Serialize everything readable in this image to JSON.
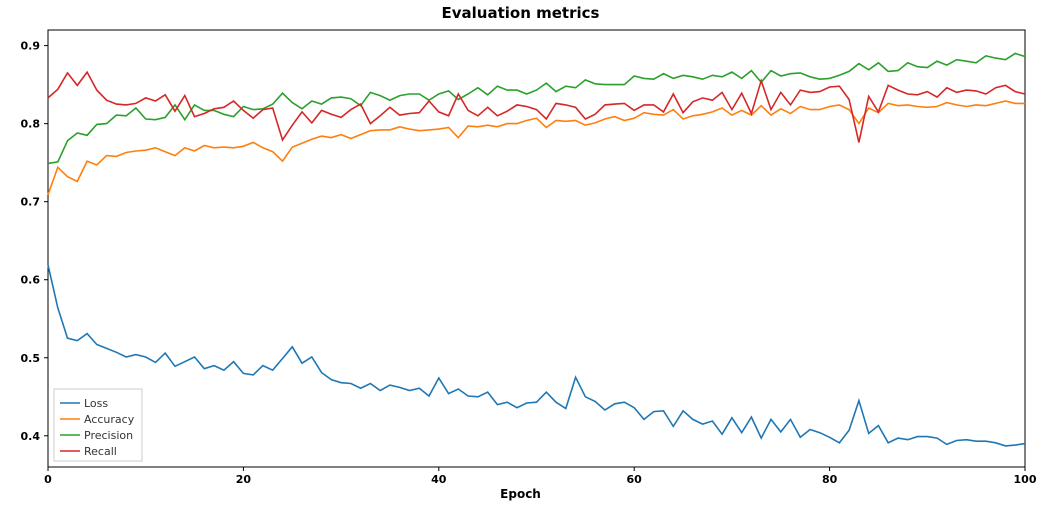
{
  "chart_data": {
    "type": "line",
    "title": "Evaluation metrics",
    "xlabel": "Epoch",
    "ylabel": "",
    "xlim": [
      0,
      100
    ],
    "ylim": [
      0.36,
      0.92
    ],
    "x_ticks": [
      0,
      20,
      40,
      60,
      80,
      100
    ],
    "y_ticks": [
      0.4,
      0.5,
      0.6,
      0.7,
      0.8,
      0.9
    ],
    "legend_position": "lower-left",
    "colors": {
      "Loss": "#1f77b4",
      "Accuracy": "#ff7f0e",
      "Precision": "#2ca02c",
      "Recall": "#d62728"
    },
    "x": [
      0,
      1,
      2,
      3,
      4,
      5,
      6,
      7,
      8,
      9,
      10,
      11,
      12,
      13,
      14,
      15,
      16,
      17,
      18,
      19,
      20,
      21,
      22,
      23,
      24,
      25,
      26,
      27,
      28,
      29,
      30,
      31,
      32,
      33,
      34,
      35,
      36,
      37,
      38,
      39,
      40,
      41,
      42,
      43,
      44,
      45,
      46,
      47,
      48,
      49,
      50,
      51,
      52,
      53,
      54,
      55,
      56,
      57,
      58,
      59,
      60,
      61,
      62,
      63,
      64,
      65,
      66,
      67,
      68,
      69,
      70,
      71,
      72,
      73,
      74,
      75,
      76,
      77,
      78,
      79,
      80,
      81,
      82,
      83,
      84,
      85,
      86,
      87,
      88,
      89,
      90,
      91,
      92,
      93,
      94,
      95,
      96,
      97,
      98,
      99,
      100
    ],
    "series": [
      {
        "name": "Loss",
        "values": [
          0.619,
          0.564,
          0.525,
          0.522,
          0.531,
          0.517,
          0.512,
          0.507,
          0.501,
          0.504,
          0.501,
          0.494,
          0.506,
          0.489,
          0.495,
          0.501,
          0.486,
          0.49,
          0.484,
          0.495,
          0.48,
          0.478,
          0.49,
          0.484,
          0.499,
          0.514,
          0.493,
          0.501,
          0.481,
          0.472,
          0.468,
          0.467,
          0.461,
          0.467,
          0.458,
          0.465,
          0.462,
          0.458,
          0.461,
          0.451,
          0.474,
          0.454,
          0.46,
          0.451,
          0.45,
          0.456,
          0.44,
          0.443,
          0.436,
          0.442,
          0.443,
          0.456,
          0.443,
          0.435,
          0.475,
          0.45,
          0.444,
          0.433,
          0.441,
          0.443,
          0.436,
          0.421,
          0.431,
          0.432,
          0.412,
          0.432,
          0.421,
          0.415,
          0.419,
          0.402,
          0.423,
          0.404,
          0.424,
          0.397,
          0.421,
          0.405,
          0.421,
          0.398,
          0.408,
          0.404,
          0.398,
          0.391,
          0.407,
          0.445,
          0.403,
          0.413,
          0.391,
          0.397,
          0.395,
          0.399,
          0.399,
          0.397,
          0.389,
          0.394,
          0.395,
          0.393,
          0.393,
          0.391,
          0.387,
          0.388,
          0.39
        ]
      },
      {
        "name": "Accuracy",
        "values": [
          0.709,
          0.744,
          0.732,
          0.726,
          0.752,
          0.747,
          0.759,
          0.758,
          0.763,
          0.765,
          0.766,
          0.769,
          0.764,
          0.759,
          0.769,
          0.765,
          0.772,
          0.769,
          0.77,
          0.769,
          0.771,
          0.776,
          0.769,
          0.764,
          0.752,
          0.77,
          0.775,
          0.78,
          0.784,
          0.782,
          0.786,
          0.781,
          0.786,
          0.791,
          0.792,
          0.792,
          0.796,
          0.793,
          0.791,
          0.792,
          0.793,
          0.795,
          0.782,
          0.797,
          0.796,
          0.798,
          0.796,
          0.8,
          0.8,
          0.804,
          0.807,
          0.795,
          0.804,
          0.803,
          0.804,
          0.798,
          0.801,
          0.806,
          0.809,
          0.804,
          0.807,
          0.814,
          0.812,
          0.811,
          0.818,
          0.806,
          0.81,
          0.812,
          0.815,
          0.82,
          0.811,
          0.817,
          0.811,
          0.823,
          0.811,
          0.819,
          0.813,
          0.822,
          0.818,
          0.818,
          0.822,
          0.824,
          0.818,
          0.8,
          0.82,
          0.814,
          0.826,
          0.823,
          0.824,
          0.822,
          0.821,
          0.822,
          0.827,
          0.824,
          0.822,
          0.824,
          0.823,
          0.826,
          0.829,
          0.826,
          0.826
        ]
      },
      {
        "name": "Precision",
        "values": [
          0.749,
          0.751,
          0.778,
          0.788,
          0.785,
          0.799,
          0.8,
          0.811,
          0.81,
          0.82,
          0.806,
          0.805,
          0.808,
          0.824,
          0.805,
          0.824,
          0.817,
          0.817,
          0.812,
          0.809,
          0.822,
          0.818,
          0.819,
          0.825,
          0.839,
          0.827,
          0.819,
          0.829,
          0.825,
          0.833,
          0.834,
          0.832,
          0.823,
          0.84,
          0.836,
          0.83,
          0.836,
          0.838,
          0.838,
          0.83,
          0.838,
          0.842,
          0.831,
          0.838,
          0.846,
          0.837,
          0.848,
          0.843,
          0.843,
          0.838,
          0.843,
          0.852,
          0.841,
          0.848,
          0.846,
          0.856,
          0.851,
          0.85,
          0.85,
          0.85,
          0.861,
          0.858,
          0.857,
          0.864,
          0.858,
          0.862,
          0.86,
          0.857,
          0.862,
          0.86,
          0.866,
          0.858,
          0.868,
          0.853,
          0.868,
          0.861,
          0.864,
          0.865,
          0.86,
          0.857,
          0.858,
          0.862,
          0.867,
          0.877,
          0.869,
          0.878,
          0.867,
          0.868,
          0.878,
          0.873,
          0.872,
          0.88,
          0.875,
          0.882,
          0.88,
          0.878,
          0.887,
          0.884,
          0.882,
          0.89,
          0.886
        ]
      },
      {
        "name": "Recall",
        "values": [
          0.833,
          0.844,
          0.865,
          0.849,
          0.866,
          0.843,
          0.83,
          0.825,
          0.824,
          0.826,
          0.833,
          0.829,
          0.837,
          0.816,
          0.836,
          0.809,
          0.813,
          0.819,
          0.821,
          0.829,
          0.817,
          0.807,
          0.818,
          0.82,
          0.779,
          0.798,
          0.815,
          0.801,
          0.817,
          0.812,
          0.808,
          0.818,
          0.825,
          0.8,
          0.81,
          0.821,
          0.811,
          0.813,
          0.814,
          0.829,
          0.815,
          0.81,
          0.838,
          0.817,
          0.81,
          0.821,
          0.81,
          0.816,
          0.824,
          0.822,
          0.818,
          0.806,
          0.826,
          0.824,
          0.821,
          0.806,
          0.812,
          0.824,
          0.825,
          0.826,
          0.817,
          0.824,
          0.824,
          0.815,
          0.838,
          0.814,
          0.828,
          0.833,
          0.83,
          0.84,
          0.818,
          0.839,
          0.813,
          0.855,
          0.818,
          0.84,
          0.824,
          0.843,
          0.84,
          0.841,
          0.847,
          0.848,
          0.831,
          0.776,
          0.835,
          0.815,
          0.849,
          0.843,
          0.838,
          0.837,
          0.841,
          0.834,
          0.846,
          0.84,
          0.843,
          0.842,
          0.838,
          0.846,
          0.849,
          0.841,
          0.838
        ]
      }
    ]
  }
}
